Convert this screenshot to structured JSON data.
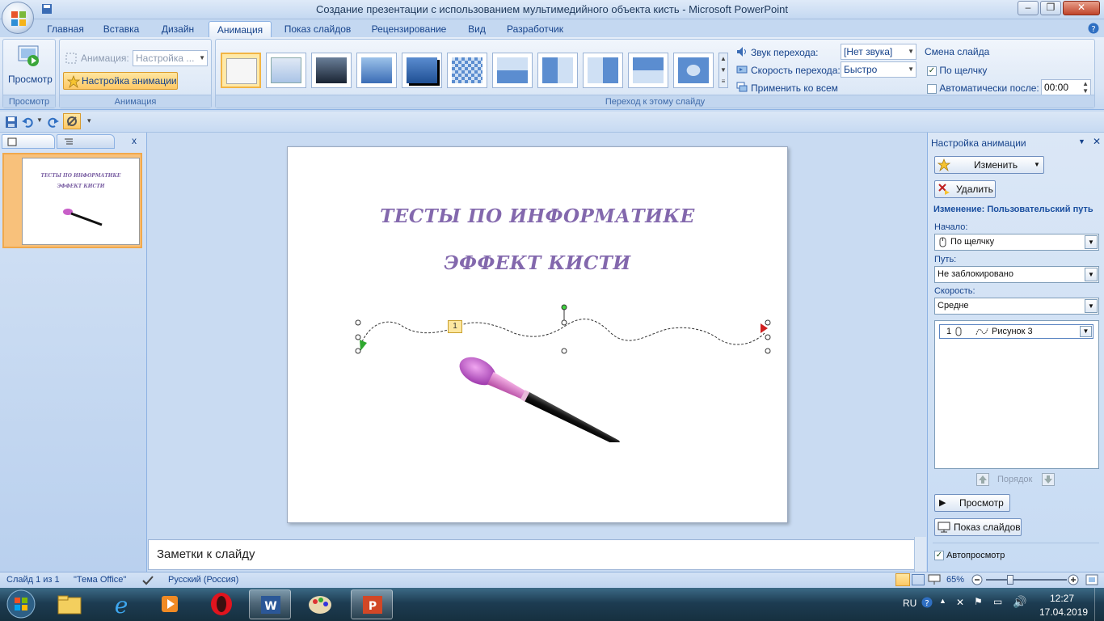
{
  "window": {
    "title": "Создание презентации с использованием мультимедийного объекта кисть - Microsoft PowerPoint"
  },
  "tabs": [
    "Главная",
    "Вставка",
    "Дизайн",
    "Анимация",
    "Показ слайдов",
    "Рецензирование",
    "Вид",
    "Разработчик"
  ],
  "active_tab": "Анимация",
  "ribbon": {
    "preview_group": {
      "button": "Просмотр",
      "label": "Просмотр"
    },
    "animation_group": {
      "animation_label": "Анимация:",
      "animation_value": "Настройка ...",
      "custom_button": "Настройка анимации",
      "label": "Анимация"
    },
    "transition_group": {
      "label": "Переход к этому слайду",
      "sound_label": "Звук перехода:",
      "sound_value": "[Нет звука]",
      "speed_label": "Скорость перехода:",
      "speed_value": "Быстро",
      "apply_all": "Применить ко всем"
    },
    "advance_group": {
      "title": "Смена слайда",
      "on_click": "По щелчку",
      "auto_after": "Автоматически после:",
      "time": "00:00"
    }
  },
  "slide_pane": {
    "slide_number": "1",
    "thumb_title1": "ТЕСТЫ ПО ИНФОРМАТИКЕ",
    "thumb_title2": "ЭФФЕКТ КИСТИ"
  },
  "slide": {
    "title": "ТЕСТЫ ПО ИНФОРМАТИКЕ",
    "subtitle": "ЭФФЕКТ КИСТИ",
    "path_tag": "1"
  },
  "notes": {
    "placeholder": "Заметки к слайду"
  },
  "task_pane": {
    "title": "Настройка анимации",
    "change_button": "Изменить",
    "delete_button": "Удалить",
    "change_label": "Изменение: Пользовательский путь",
    "start_label": "Начало:",
    "start_value": "По щелчку",
    "path_label": "Путь:",
    "path_value": "Не заблокировано",
    "speed_label": "Скорость:",
    "speed_value": "Средне",
    "item_number": "1",
    "item_name": "Рисунок 3",
    "order_label": "Порядок",
    "preview_button": "Просмотр",
    "slideshow_button": "Показ слайдов",
    "autopreview_label": "Автопросмотр"
  },
  "status": {
    "slide": "Слайд 1 из 1",
    "theme": "\"Тема Office\"",
    "language": "Русский (Россия)",
    "zoom": "65%"
  },
  "taskbar": {
    "lang": "RU",
    "time": "12:27",
    "date": "17.04.2019"
  },
  "colors": {
    "title_purple": "#8368ad",
    "ribbon_blue": "#15428b"
  }
}
